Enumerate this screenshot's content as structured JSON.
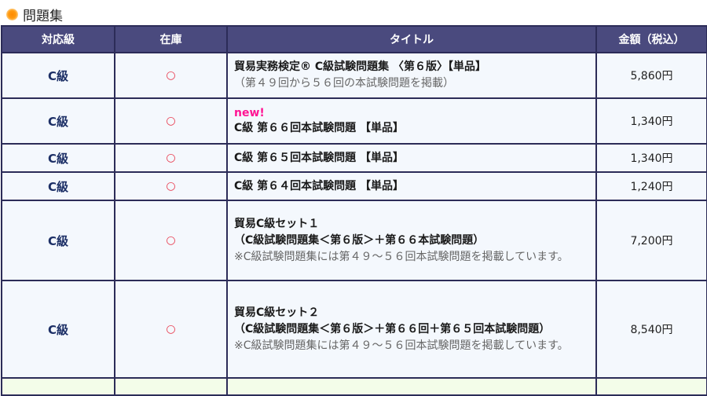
{
  "section": {
    "title": "問題集",
    "icon": "orange-circle-bullet-icon"
  },
  "table": {
    "headers": [
      "対応級",
      "在庫",
      "タイトル",
      "金額（税込）"
    ],
    "rows": [
      {
        "grade": "C級",
        "stock": "○",
        "new_label": "",
        "title_lines": [
          "貿易実務検定® C級試験問題集 〈第６版〉【単品】"
        ],
        "sub_lines": [
          "（第４９回から５６回の本試験問題を掲載）"
        ],
        "price": "5,860円"
      },
      {
        "grade": "C級",
        "stock": "○",
        "new_label": "new!",
        "title_lines": [
          "C級 第６６回本試験問題 【単品】"
        ],
        "sub_lines": [],
        "price": "1,340円"
      },
      {
        "grade": "C級",
        "stock": "○",
        "new_label": "",
        "title_lines": [
          "C級 第６５回本試験問題 【単品】"
        ],
        "sub_lines": [],
        "price": "1,340円"
      },
      {
        "grade": "C級",
        "stock": "○",
        "new_label": "",
        "title_lines": [
          "C級 第６４回本試験問題 【単品】"
        ],
        "sub_lines": [],
        "price": "1,240円"
      },
      {
        "grade": "C級",
        "stock": "○",
        "new_label": "",
        "title_lines": [
          "貿易C級セット１",
          "（C級試験問題集＜第６版＞＋第６６本試験問題）"
        ],
        "sub_lines": [
          "※C級試験問題集には第４９～５６回本試験問題を掲載しています。"
        ],
        "price": "7,200円"
      },
      {
        "grade": "C級",
        "stock": "○",
        "new_label": "",
        "title_lines": [
          "貿易C級セット２",
          "（C級試験問題集＜第６版＞＋第６６回＋第６５回本試験問題）"
        ],
        "sub_lines": [
          "※C級試験問題集には第４９～５６回本試験問題を掲載しています。"
        ],
        "price": "8,540円"
      }
    ]
  }
}
